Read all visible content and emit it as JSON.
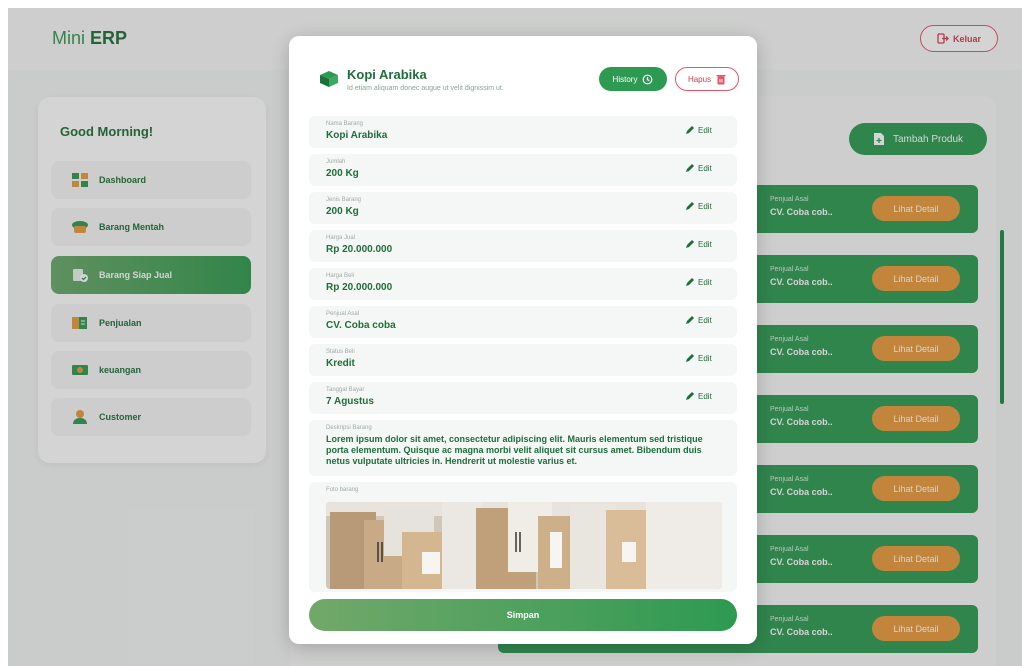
{
  "header": {
    "logo_prefix": "Mini",
    "logo_bold": "ERP",
    "logout_label": "Keluar"
  },
  "sidebar": {
    "greeting": "Good Morning!",
    "items": [
      {
        "label": "Dashboard",
        "icon": "dashboard-icon"
      },
      {
        "label": "Barang Mentah",
        "icon": "raw-goods-icon"
      },
      {
        "label": "Barang Siap Jual",
        "icon": "ready-goods-icon",
        "active": true
      },
      {
        "label": "Penjualan",
        "icon": "sales-icon"
      },
      {
        "label": "keuangan",
        "icon": "finance-icon"
      },
      {
        "label": "Customer",
        "icon": "customer-icon"
      }
    ]
  },
  "main": {
    "add_button": "Tambah Produk",
    "cards": [
      {
        "seller_label": "Penjual Asal",
        "seller": "CV. Coba cob..",
        "button": "Lihat Detail"
      },
      {
        "seller_label": "Penjual Asal",
        "seller": "CV. Coba cob..",
        "button": "Lihat Detail"
      },
      {
        "seller_label": "Penjual Asal",
        "seller": "CV. Coba cob..",
        "button": "Lihat Detail"
      },
      {
        "seller_label": "Penjual Asal",
        "seller": "CV. Coba cob..",
        "button": "Lihat Detail"
      },
      {
        "seller_label": "Penjual Asal",
        "seller": "CV. Coba cob..",
        "button": "Lihat Detail"
      },
      {
        "seller_label": "Penjual Asal",
        "seller": "CV. Coba cob..",
        "button": "Lihat Detail"
      },
      {
        "seller_label": "Penjual Asal",
        "seller": "CV. Coba cob..",
        "button": "Lihat Detail"
      }
    ]
  },
  "modal": {
    "title": "Kopi Arabika",
    "subtitle": "Id etiam aliquam donec augue ut velit dignissim ut.",
    "history_label": "History",
    "delete_label": "Hapus",
    "edit_label": "Edit",
    "fields": [
      {
        "label": "Nama Barang",
        "value": "Kopi Arabika"
      },
      {
        "label": "Jumlah",
        "value": "200 Kg"
      },
      {
        "label": "Jenis Barang",
        "value": "200 Kg"
      },
      {
        "label": "Harga Jual",
        "value": "Rp 20.000.000"
      },
      {
        "label": "Harga Beli",
        "value": "Rp 20.000.000"
      },
      {
        "label": "Penjual Asal",
        "value": "CV. Coba coba"
      },
      {
        "label": "Status Beli",
        "value": "Kredit"
      },
      {
        "label": "Tanggal Bayar",
        "value": "7 Agustus"
      }
    ],
    "description": {
      "label": "Deskripsi Barang",
      "value": "Lorem ipsum dolor sit amet, consectetur adipiscing elit. Mauris elementum sed tristique porta elementum. Quisque ac magna morbi velit aliquet sit cursus amet. Bibendum duis netus vulputate ultricies in. Hendrerit ut molestie varius et."
    },
    "photo_label": "Foto barang",
    "save_label": "Simpan"
  },
  "colors": {
    "primary": "#2d9a52",
    "dark_green": "#1d6f3a",
    "accent_orange": "#e89a3c",
    "danger": "#e3556a"
  }
}
